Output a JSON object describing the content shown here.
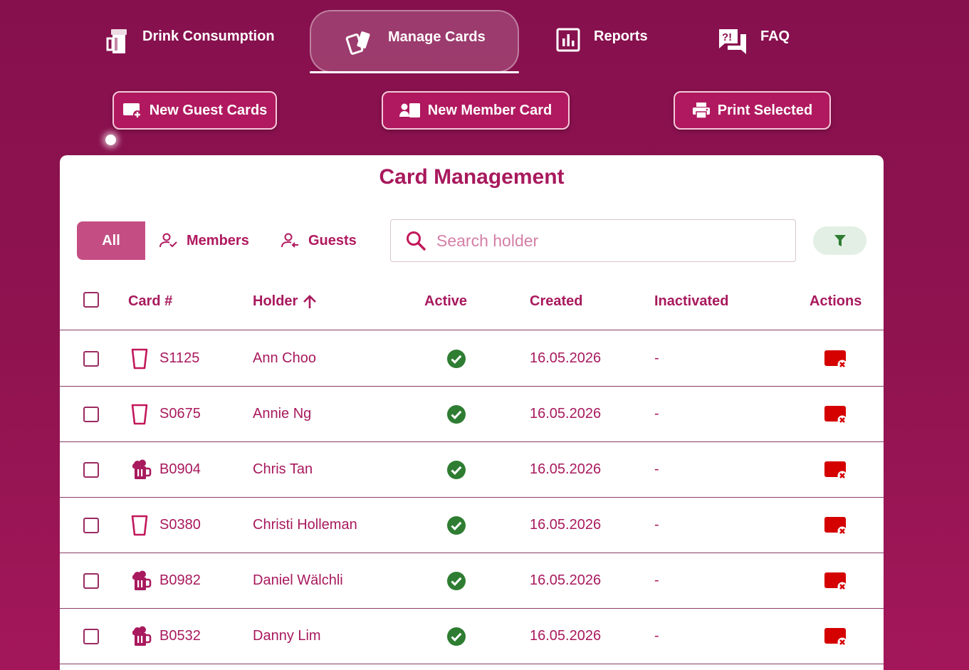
{
  "nav": {
    "tabs": [
      {
        "label": "Drink Consumption",
        "icon": "beer-tap-icon"
      },
      {
        "label": "Manage Cards",
        "icon": "cards-icon",
        "active": true
      },
      {
        "label": "Reports",
        "icon": "bar-chart-icon"
      },
      {
        "label": "FAQ",
        "icon": "faq-icon"
      }
    ]
  },
  "toolbar": {
    "new_guest": "New Guest Cards",
    "new_member": "New Member Card",
    "print": "Print Selected"
  },
  "card": {
    "title": "Card Management",
    "filters": {
      "all": "All",
      "members": "Members",
      "guests": "Guests",
      "selected": "All"
    },
    "search_placeholder": "Search holder",
    "columns": {
      "card": "Card #",
      "holder": "Holder",
      "active": "Active",
      "created": "Created",
      "inactivated": "Inactivated",
      "actions": "Actions"
    },
    "sort": {
      "column": "holder",
      "direction": "ascending"
    }
  },
  "rows": [
    {
      "type": "glass",
      "card": "S1125",
      "holder": "Ann Choo",
      "active": true,
      "created": "16.05.2026",
      "inactivated": "-"
    },
    {
      "type": "glass",
      "card": "S0675",
      "holder": "Annie Ng",
      "active": true,
      "created": "16.05.2026",
      "inactivated": "-"
    },
    {
      "type": "beer",
      "card": "B0904",
      "holder": "Chris Tan",
      "active": true,
      "created": "16.05.2026",
      "inactivated": "-"
    },
    {
      "type": "glass",
      "card": "S0380",
      "holder": "Christi Holleman",
      "active": true,
      "created": "16.05.2026",
      "inactivated": "-"
    },
    {
      "type": "beer",
      "card": "B0982",
      "holder": "Daniel Wälchli",
      "active": true,
      "created": "16.05.2026",
      "inactivated": "-"
    },
    {
      "type": "beer",
      "card": "B0532",
      "holder": "Danny Lim",
      "active": true,
      "created": "16.05.2026",
      "inactivated": "-"
    }
  ],
  "colors": {
    "brand": "#a8195d",
    "background": "#8a114e",
    "active_check": "#2e7d32",
    "delete": "#d50000",
    "filter_bg": "#e3efe4"
  }
}
